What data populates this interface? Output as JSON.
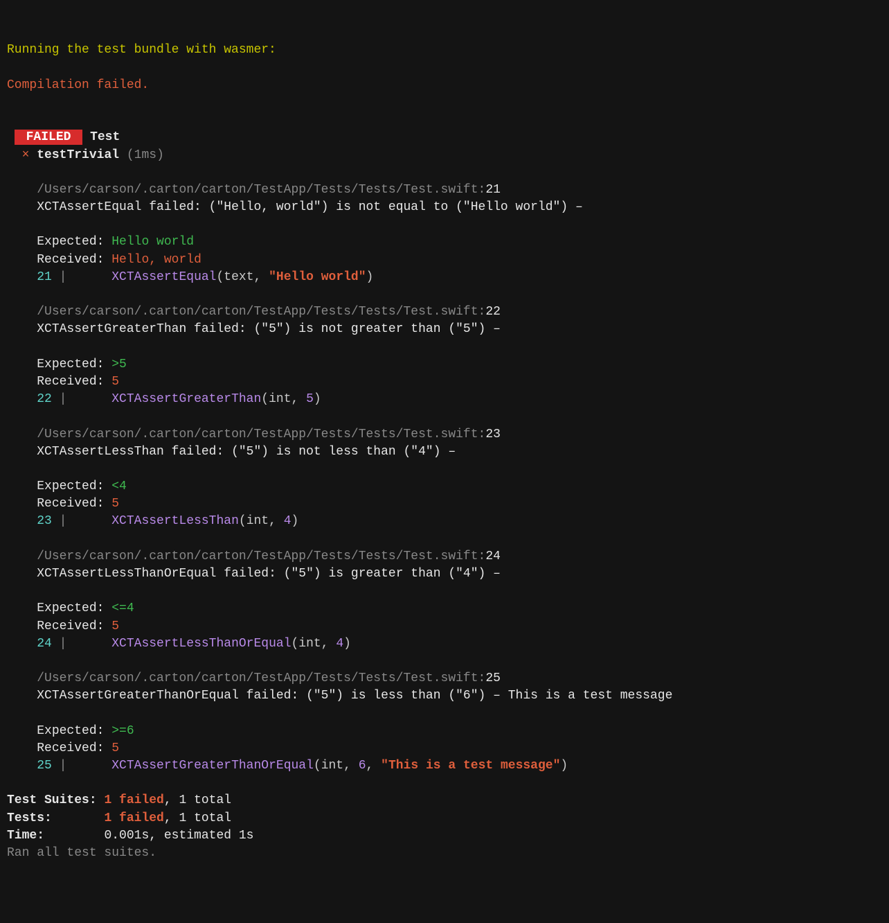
{
  "header": {
    "running": "Running the test bundle with wasmer:",
    "compilation": "Compilation failed."
  },
  "badge": {
    "failed": "FAILED",
    "suite": "Test"
  },
  "test": {
    "cross": "×",
    "name": "testTrivial",
    "time": "(1ms)"
  },
  "file": {
    "path": "/Users/carson/.carton/carton/TestApp/Tests/Tests/Test.swift"
  },
  "labels": {
    "expected": "Expected:",
    "received": "Received:"
  },
  "pipe": " |      ",
  "failures": [
    {
      "line": "21",
      "msg": "XCTAssertEqual failed: (\"Hello, world\") is not equal to (\"Hello world\") –",
      "expected": "Hello world",
      "received": "Hello, world",
      "code_fn": "XCTAssertEqual",
      "code_args_prefix": "(text, ",
      "code_string": "\"Hello world\"",
      "code_args_suffix": ")"
    },
    {
      "line": "22",
      "msg": "XCTAssertGreaterThan failed: (\"5\") is not greater than (\"5\") –",
      "expected": ">5",
      "received": "5",
      "code_fn": "XCTAssertGreaterThan",
      "code_args_prefix": "(int, ",
      "code_num": "5",
      "code_args_suffix": ")"
    },
    {
      "line": "23",
      "msg": "XCTAssertLessThan failed: (\"5\") is not less than (\"4\") –",
      "expected": "<4",
      "received": "5",
      "code_fn": "XCTAssertLessThan",
      "code_args_prefix": "(int, ",
      "code_num": "4",
      "code_args_suffix": ")"
    },
    {
      "line": "24",
      "msg": "XCTAssertLessThanOrEqual failed: (\"5\") is greater than (\"4\") –",
      "expected": "<=4",
      "received": "5",
      "code_fn": "XCTAssertLessThanOrEqual",
      "code_args_prefix": "(int, ",
      "code_num": "4",
      "code_args_suffix": ")"
    },
    {
      "line": "25",
      "msg": "XCTAssertGreaterThanOrEqual failed: (\"5\") is less than (\"6\") – This is a test message",
      "expected": ">=6",
      "received": "5",
      "code_fn": "XCTAssertGreaterThanOrEqual",
      "code_args_prefix": "(int, ",
      "code_num": "6",
      "code_args_mid": ", ",
      "code_string": "\"This is a test message\"",
      "code_args_suffix": ")"
    }
  ],
  "summary": {
    "suites_label": "Test Suites:",
    "suites_fail": "1 failed",
    "suites_total": ", 1 total",
    "tests_label": "Tests:      ",
    "tests_fail": "1 failed",
    "tests_total": ", 1 total",
    "time_label": "Time:       ",
    "time_value": "0.001s, estimated 1s",
    "ran": "Ran all test suites."
  }
}
